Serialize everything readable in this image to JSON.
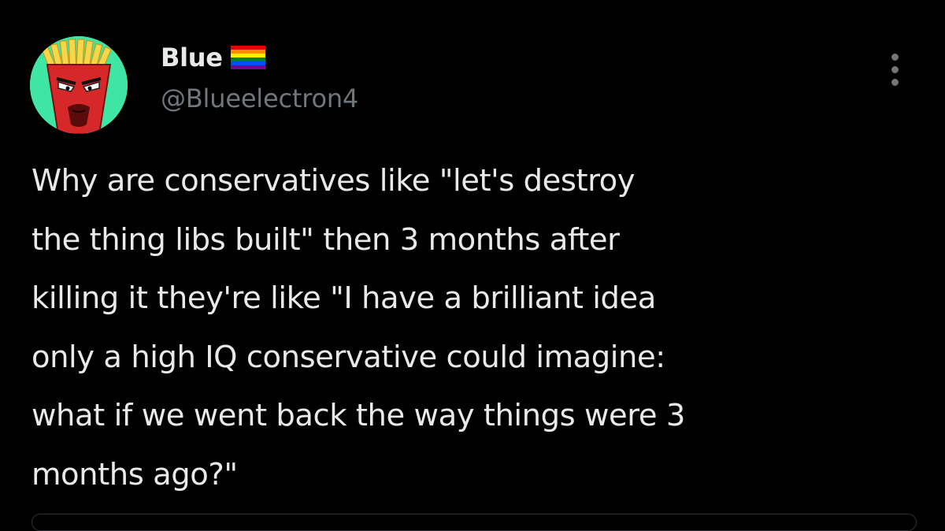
{
  "user": {
    "display_name": "Blue",
    "handle": "@Blueelectron4",
    "badge_icon": "rainbow-flag-icon",
    "avatar_background": "#3fe6a3"
  },
  "tweet": {
    "text": "Why are conservatives like \"let's destroy\nthe thing libs built\" then 3 months after\nkilling it they're like \"I have a brilliant idea\nonly a high IQ conservative could imagine:\nwhat if we went back the way things were 3\nmonths ago?\""
  },
  "menu": {
    "icon": "more-options-icon"
  },
  "colors": {
    "background": "#000000",
    "primary_text": "#e7e9ea",
    "secondary_text": "#71767b"
  }
}
